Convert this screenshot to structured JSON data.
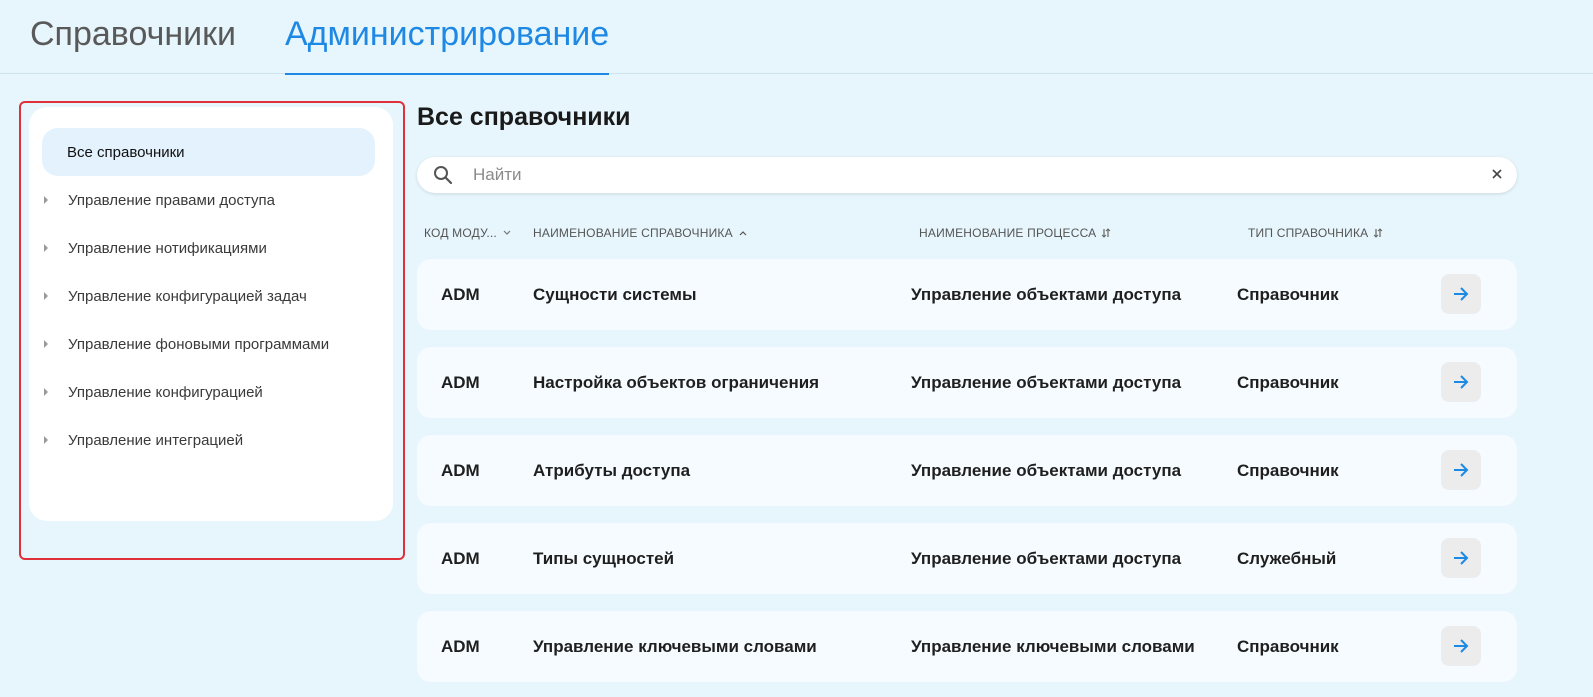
{
  "top_tabs": [
    {
      "label": "Справочники",
      "active": false
    },
    {
      "label": "Администрирование",
      "active": true
    }
  ],
  "sidebar": {
    "items": [
      {
        "label": "Все справочники",
        "selected": true
      },
      {
        "label": "Управление правами доступа"
      },
      {
        "label": "Управление нотификациями"
      },
      {
        "label": "Управление конфигурацией задач"
      },
      {
        "label": "Управление фоновыми программами"
      },
      {
        "label": "Управление конфигурацией"
      },
      {
        "label": "Управление интеграцией"
      }
    ]
  },
  "main": {
    "title": "Все справочники",
    "search": {
      "placeholder": "Найти",
      "value": ""
    },
    "columns": [
      {
        "label": "КОД МОДУ...",
        "sort_icon": "chevron-down-icon"
      },
      {
        "label": "НАИМЕНОВАНИЕ СПРАВОЧНИКА",
        "sort_icon": "chevron-up-icon"
      },
      {
        "label": "НАИМЕНОВАНИЕ ПРОЦЕССА",
        "sort_icon": "sort-icon"
      },
      {
        "label": "ТИП СПРАВОЧНИКА",
        "sort_icon": "sort-icon"
      }
    ],
    "rows": [
      {
        "code": "ADM",
        "name": "Сущности системы",
        "process": "Управление объектами доступа",
        "type": "Справочник"
      },
      {
        "code": "ADM",
        "name": "Настройка объектов ограничения",
        "process": "Управление объектами доступа",
        "type": "Справочник"
      },
      {
        "code": "ADM",
        "name": "Атрибуты доступа",
        "process": "Управление объектами доступа",
        "type": "Справочник"
      },
      {
        "code": "ADM",
        "name": "Типы сущностей",
        "process": "Управление объектами доступа",
        "type": "Служебный"
      },
      {
        "code": "ADM",
        "name": "Управление ключевыми словами",
        "process": "Управление ключевыми словами",
        "type": "Справочник"
      }
    ]
  },
  "colors": {
    "accent": "#1e88e5",
    "background": "#e6f6fc",
    "highlight_border": "#e0303a",
    "selected_item_bg": "#e3f2fd"
  }
}
